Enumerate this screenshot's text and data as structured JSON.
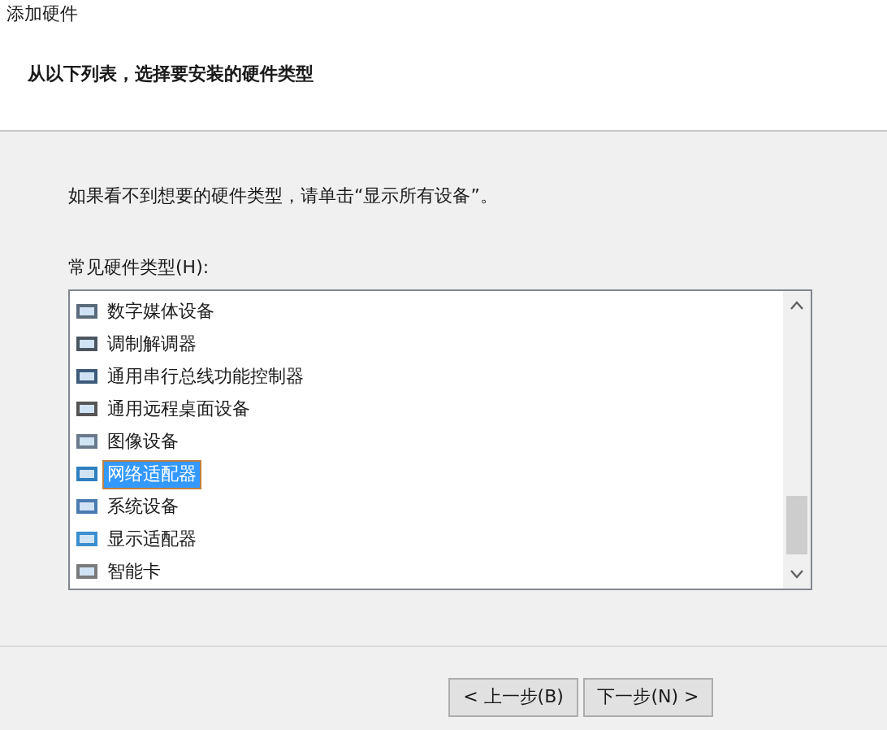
{
  "window": {
    "title": "添加硬件"
  },
  "header": {
    "heading": "从以下列表，选择要安装的硬件类型"
  },
  "body": {
    "hint": "如果看不到想要的硬件类型，请单击“显示所有设备”。",
    "list_label": "常见硬件类型(H):"
  },
  "hardware_types": [
    {
      "label": "数字媒体设备",
      "selected": false
    },
    {
      "label": "调制解调器",
      "selected": false
    },
    {
      "label": "通用串行总线功能控制器",
      "selected": false
    },
    {
      "label": "通用远程桌面设备",
      "selected": false
    },
    {
      "label": "图像设备",
      "selected": false
    },
    {
      "label": "网络适配器",
      "selected": true
    },
    {
      "label": "系统设备",
      "selected": false
    },
    {
      "label": "显示适配器",
      "selected": false
    },
    {
      "label": "智能卡",
      "selected": false
    }
  ],
  "buttons": [
    {
      "label": "< 上一步(B)"
    },
    {
      "label": "下一步(N) >"
    }
  ]
}
